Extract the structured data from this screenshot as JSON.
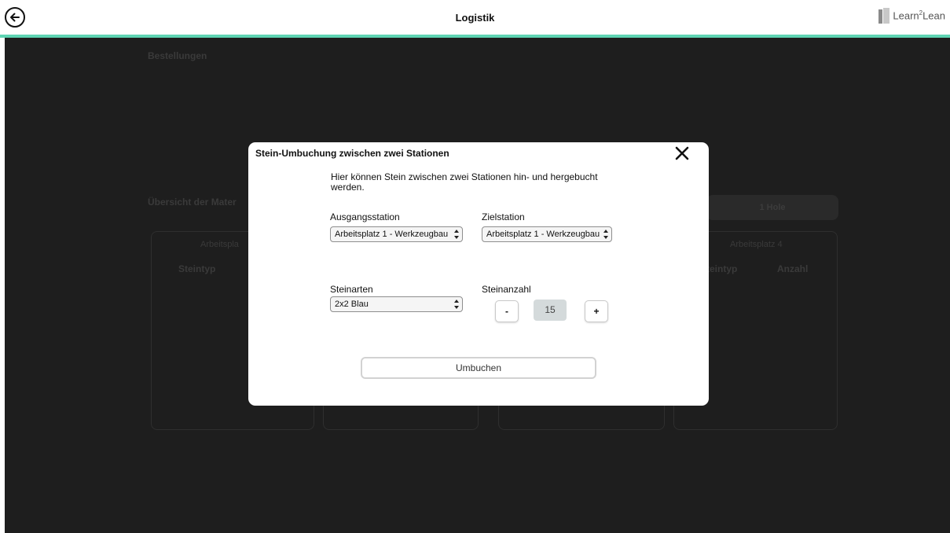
{
  "header": {
    "title": "Logistik",
    "back_icon": "arrow-left-circle-icon",
    "logo_text": "Learn",
    "logo_sup": "2",
    "logo_text2": "Lean",
    "accent_color": "#5fd4b3"
  },
  "background": {
    "orders_heading": "Bestellungen",
    "overview_heading": "Übersicht der Mater",
    "pill_label": "1 Hole",
    "cards": [
      {
        "title": "Arbeitspla",
        "col1": "Steintyp",
        "col2": ""
      },
      {
        "title": "",
        "col1": "",
        "col2": ""
      },
      {
        "title": "",
        "col1": "",
        "col2": ""
      },
      {
        "title": "Arbeitsplatz 4",
        "col1": "teintyp",
        "col2": "Anzahl"
      }
    ]
  },
  "modal": {
    "title": "Stein-Umbuchung zwischen zwei Stationen",
    "close_icon": "close-icon",
    "description": "Hier können Stein zwischen zwei Stationen hin- und hergebucht werden.",
    "source_label": "Ausgangsstation",
    "source_value": "Arbeitsplatz 1 - Werkzeugbau",
    "target_label": "Zielstation",
    "target_value": "Arbeitsplatz 1 - Werkzeugbau",
    "brick_type_label": "Steinarten",
    "brick_type_value": "2x2 Blau",
    "brick_count_label": "Steinanzahl",
    "decrement_label": "-",
    "count_value": "15",
    "increment_label": "+",
    "submit_label": "Umbuchen"
  }
}
